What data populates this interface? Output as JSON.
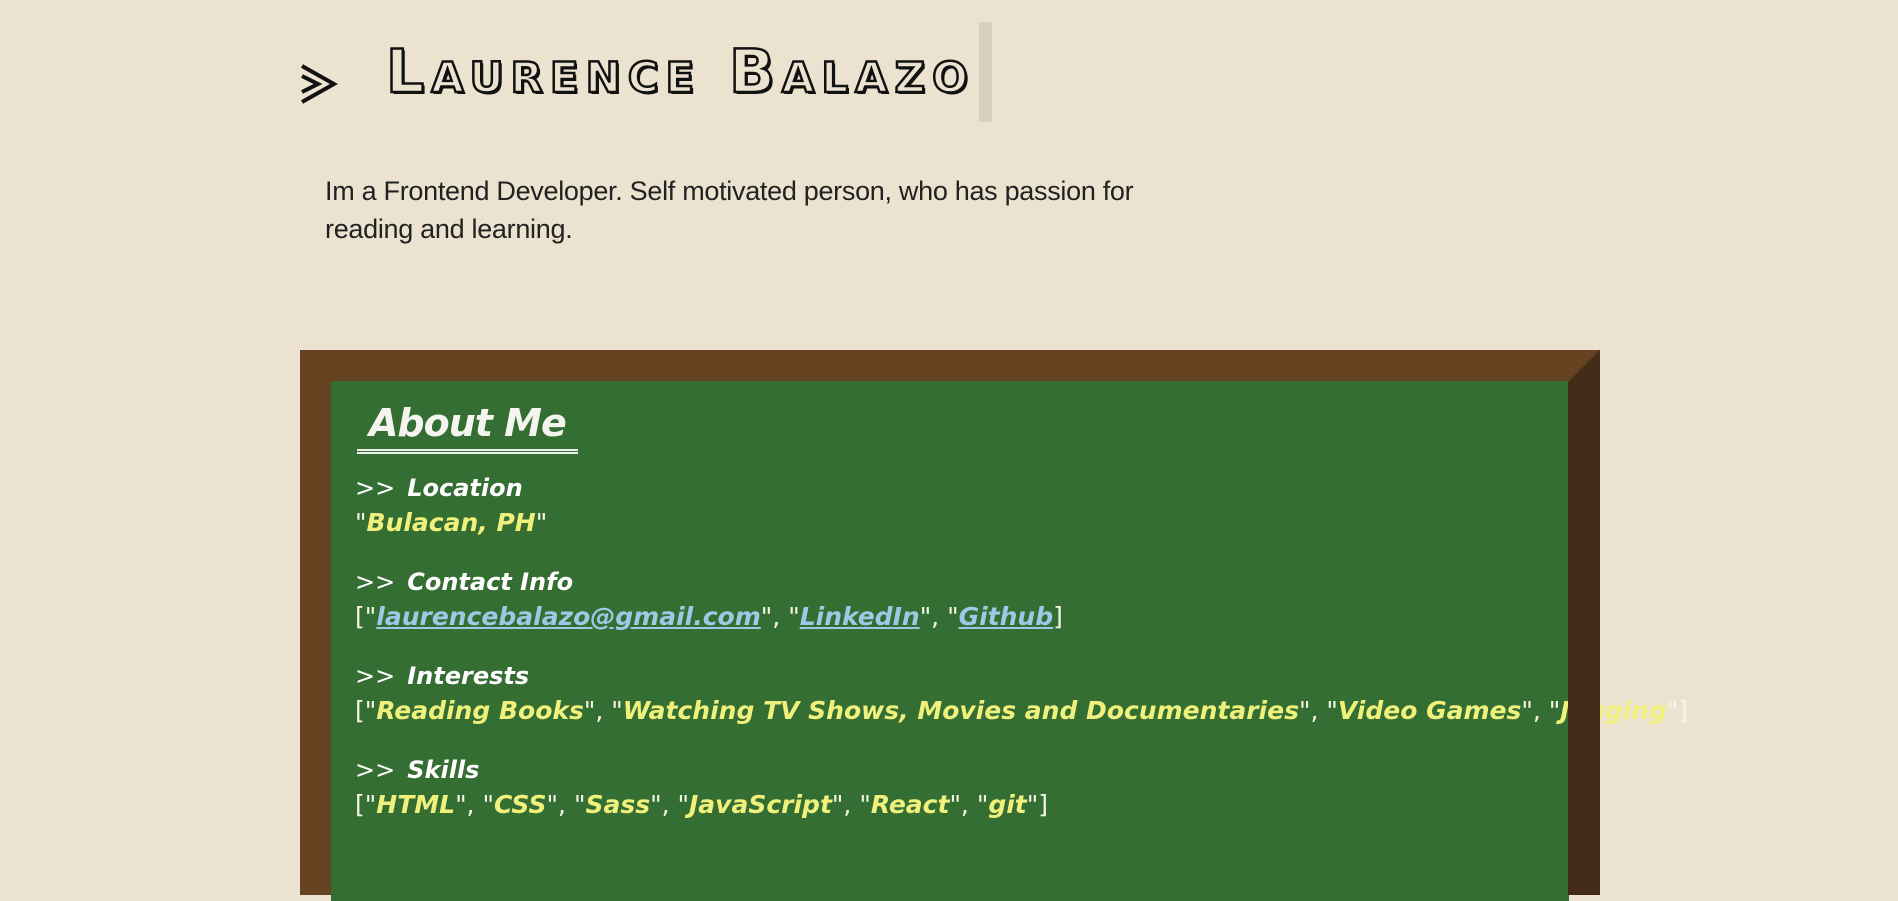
{
  "header": {
    "icon": "chevron-right-icon",
    "name": "Laurence Balazo"
  },
  "bio": {
    "text": "Im a Frontend Developer. Self motivated person, who has passion for reading and learning."
  },
  "board": {
    "title": "About Me",
    "arrows": ">>",
    "location": {
      "label": "Location",
      "value": "Bulacan, PH"
    },
    "contact": {
      "label": "Contact Info",
      "email": "laurencebalazo@gmail.com",
      "linkedin": "LinkedIn",
      "github": "Github"
    },
    "interests": {
      "label": "Interests",
      "items": [
        "Reading Books",
        "Watching TV Shows, Movies and Documentaries",
        "Video Games",
        "Jogging"
      ]
    },
    "skills": {
      "label": "Skills",
      "items": [
        "HTML",
        "CSS",
        "Sass",
        "JavaScript",
        "React",
        "git"
      ]
    }
  },
  "colors": {
    "background": "#ebe3d0",
    "board_green": "#356e32",
    "board_frame": "#654321",
    "value_yellow": "#f0f07c",
    "link_blue": "#9ec9e6"
  }
}
